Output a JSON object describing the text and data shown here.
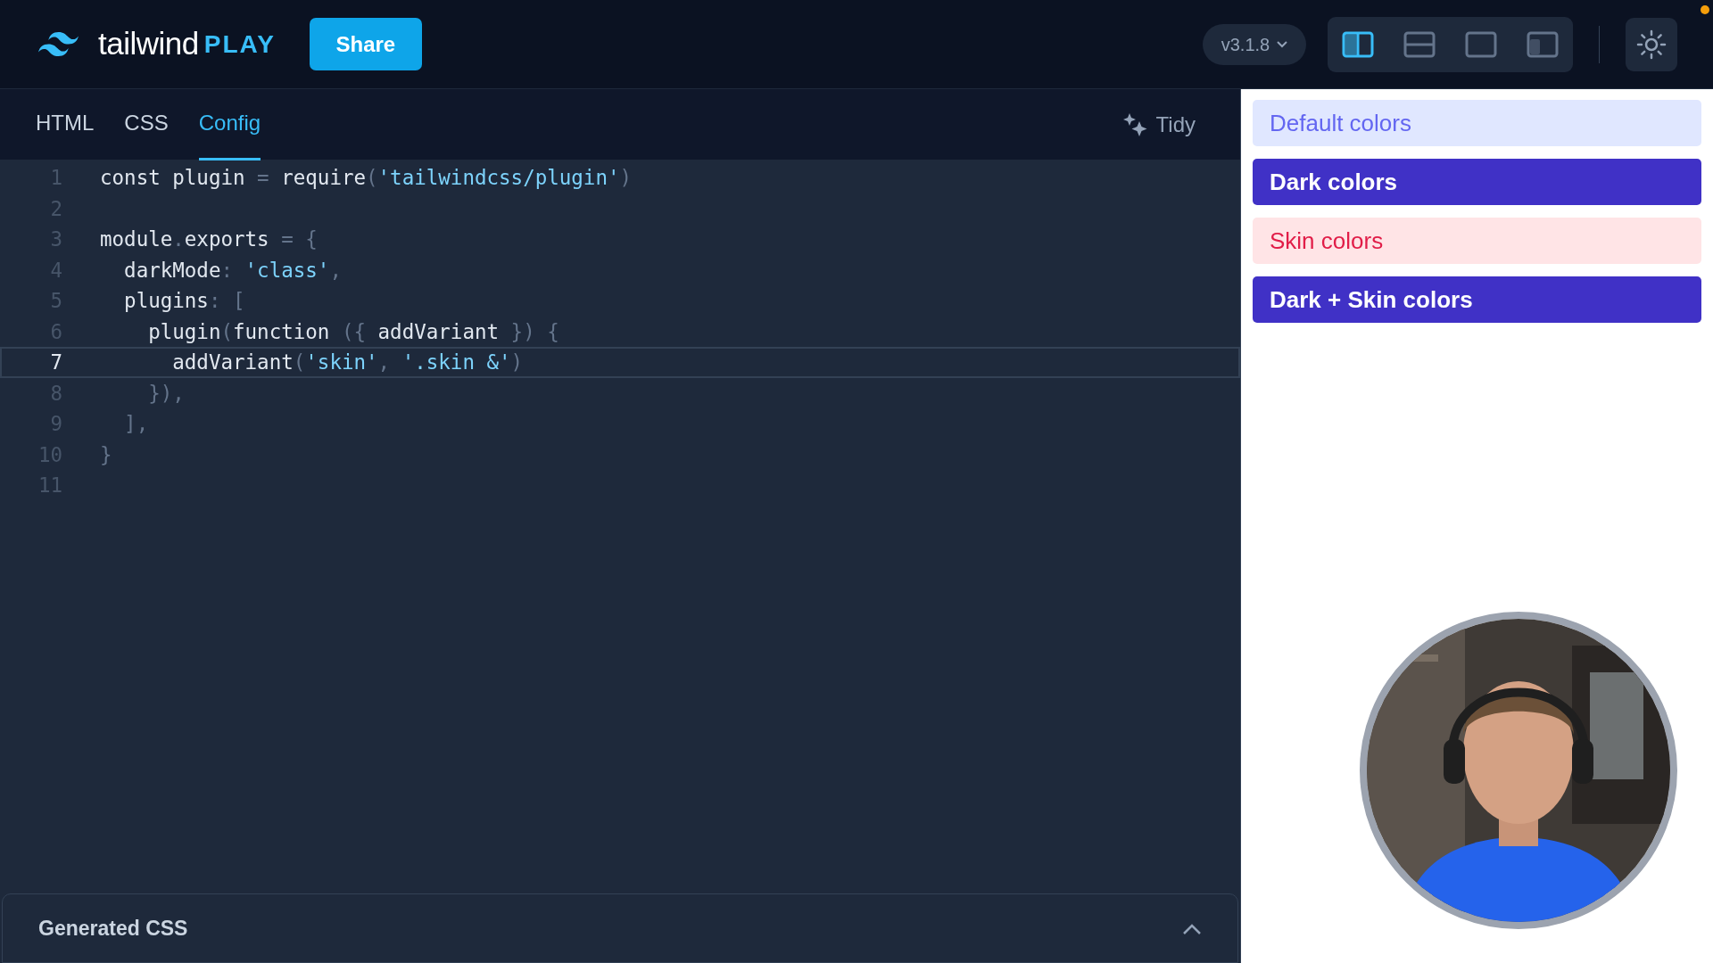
{
  "header": {
    "logo_word": "tailwind",
    "logo_tag": "PLAY",
    "share_button": "Share",
    "version": "v3.1.8",
    "layouts": [
      {
        "kind": "split-vertical",
        "selected": true
      },
      {
        "kind": "split-horizontal",
        "selected": false
      },
      {
        "kind": "editor-only",
        "selected": false
      },
      {
        "kind": "preview-only",
        "selected": false
      }
    ],
    "notification": true
  },
  "tabs": [
    {
      "label": "HTML",
      "selected": false
    },
    {
      "label": "CSS",
      "selected": false
    },
    {
      "label": "Config",
      "selected": true
    }
  ],
  "tidy_button": "Tidy",
  "editor": {
    "lines": [
      {
        "number": "1",
        "active": false,
        "tokens": [
          {
            "kind": "plain",
            "text": "const plugin "
          },
          {
            "kind": "punct",
            "text": "="
          },
          {
            "kind": "plain",
            "text": " require"
          },
          {
            "kind": "punct",
            "text": "("
          },
          {
            "kind": "string",
            "text": "'tailwindcss/plugin'"
          },
          {
            "kind": "punct",
            "text": ")"
          }
        ]
      },
      {
        "number": "2",
        "active": false
      },
      {
        "number": "3",
        "active": false,
        "tokens": [
          {
            "kind": "plain",
            "text": "module"
          },
          {
            "kind": "punct",
            "text": "."
          },
          {
            "kind": "plain",
            "text": "exports "
          },
          {
            "kind": "punct",
            "text": "= {"
          }
        ]
      },
      {
        "number": "4",
        "active": false,
        "tokens": [
          {
            "kind": "plain",
            "text": "  darkMode"
          },
          {
            "kind": "punct",
            "text": ": "
          },
          {
            "kind": "string",
            "text": "'class'"
          },
          {
            "kind": "punct",
            "text": ","
          }
        ]
      },
      {
        "number": "5",
        "active": false,
        "tokens": [
          {
            "kind": "plain",
            "text": "  plugins"
          },
          {
            "kind": "punct",
            "text": ": ["
          }
        ]
      },
      {
        "number": "6",
        "active": false,
        "tokens": [
          {
            "kind": "plain",
            "text": "    plugin"
          },
          {
            "kind": "punct",
            "text": "("
          },
          {
            "kind": "plain",
            "text": "function "
          },
          {
            "kind": "punct",
            "text": "({"
          },
          {
            "kind": "plain",
            "text": " addVariant "
          },
          {
            "kind": "punct",
            "text": "}) {"
          }
        ]
      },
      {
        "number": "7",
        "active": true,
        "tokens": [
          {
            "kind": "plain",
            "text": "      addVariant"
          },
          {
            "kind": "punct",
            "text": "("
          },
          {
            "kind": "string",
            "text": "'skin'"
          },
          {
            "kind": "punct",
            "text": ", "
          },
          {
            "kind": "string",
            "text": "'.skin &'"
          },
          {
            "kind": "punct",
            "text": ")"
          }
        ]
      },
      {
        "number": "8",
        "active": false,
        "tokens": [
          {
            "kind": "punct",
            "text": "    }),"
          }
        ]
      },
      {
        "number": "9",
        "active": false,
        "tokens": [
          {
            "kind": "punct",
            "text": "  ],"
          }
        ]
      },
      {
        "number": "10",
        "active": false,
        "tokens": [
          {
            "kind": "punct",
            "text": "}"
          }
        ]
      },
      {
        "number": "11",
        "active": false
      }
    ]
  },
  "generated_css": {
    "title": "Generated CSS",
    "expanded": false
  },
  "preview": {
    "buttons": [
      {
        "label": "Default colors",
        "kind": "default"
      },
      {
        "label": "Dark colors",
        "kind": "dark"
      },
      {
        "label": "Skin colors",
        "kind": "skin"
      },
      {
        "label": "Dark + Skin colors",
        "kind": "dark"
      }
    ]
  }
}
